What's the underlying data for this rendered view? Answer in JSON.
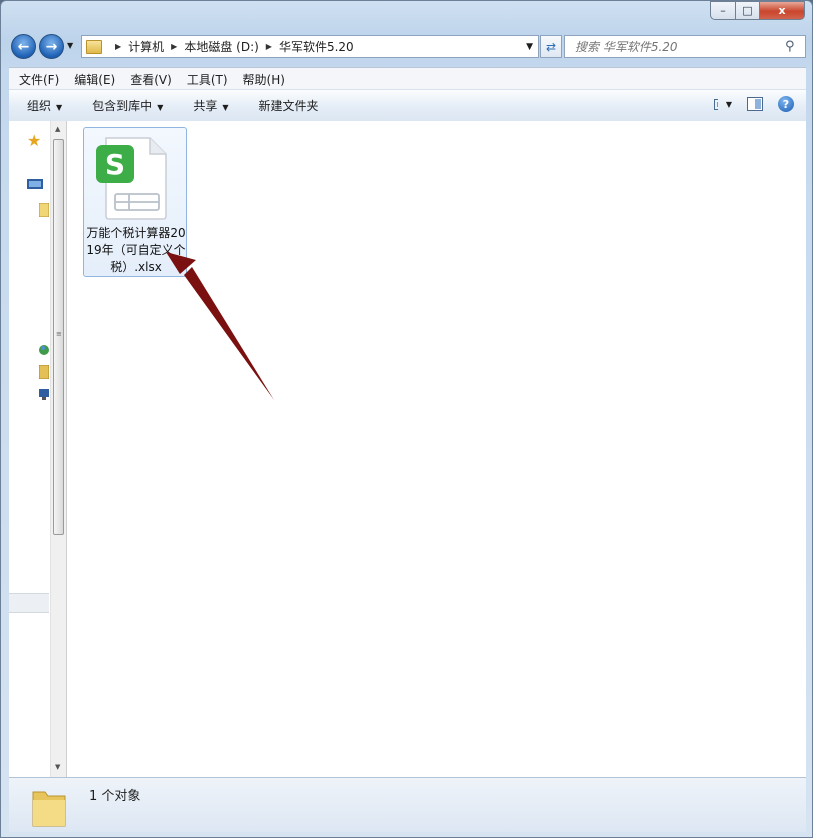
{
  "window": {
    "caption_buttons": {
      "minimize": "–",
      "maximize": "□",
      "close": "x"
    }
  },
  "nav": {
    "breadcrumb": [
      "计算机",
      "本地磁盘 (D:)",
      "华军软件5.20"
    ],
    "search_placeholder": "搜索 华军软件5.20"
  },
  "menu": [
    "文件(F)",
    "编辑(E)",
    "查看(V)",
    "工具(T)",
    "帮助(H)"
  ],
  "toolbar": {
    "organize": "组织",
    "include_library": "包含到库中",
    "share": "共享",
    "new_folder": "新建文件夹"
  },
  "file": {
    "name": "万能个税计算器2019年（可自定义个税）.xlsx",
    "icon": "wps-spreadsheet-icon",
    "icon_badge": "S",
    "badge_color": "#3dae47"
  },
  "status": {
    "count": "1 个对象"
  },
  "colors": {
    "arrow": "#7a1010",
    "accent": "#1f62b6"
  }
}
